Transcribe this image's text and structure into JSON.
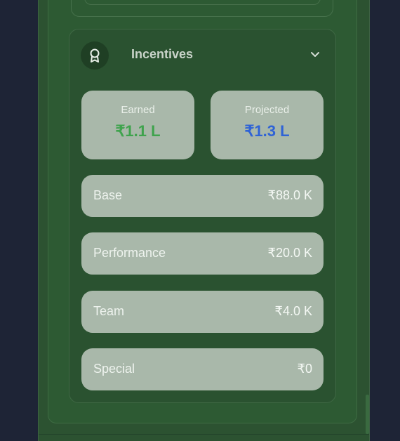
{
  "incentives": {
    "title": "Incentives",
    "earned": {
      "label": "Earned",
      "value": "₹1.1 L"
    },
    "projected": {
      "label": "Projected",
      "value": "₹1.3 L"
    },
    "rows": [
      {
        "label": "Base",
        "value": "₹88.0 K"
      },
      {
        "label": "Performance",
        "value": "₹20.0 K"
      },
      {
        "label": "Team",
        "value": "₹4.0 K"
      },
      {
        "label": "Special",
        "value": "₹0"
      }
    ]
  },
  "colors": {
    "earned_value": "#3fa34d",
    "projected_value": "#2f63d6",
    "card_bg": "#2a5230",
    "tile_bg": "#a9b8aa"
  },
  "icons": {
    "section_icon": "award-icon",
    "toggle_icon": "chevron-down-icon"
  }
}
